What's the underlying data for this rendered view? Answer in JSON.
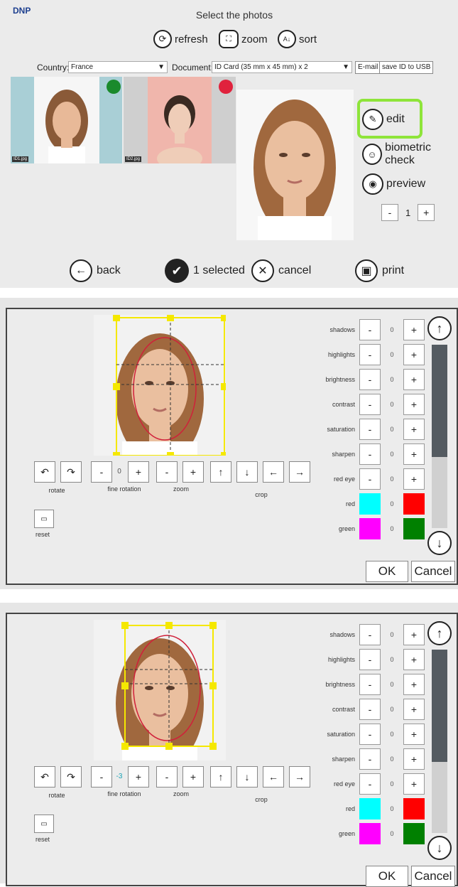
{
  "app": {
    "logo": "DNP",
    "title": "Select the photos"
  },
  "toolbar": {
    "refresh": "refresh",
    "zoom": "zoom",
    "sort": "sort"
  },
  "filters": {
    "country_label": "Country:",
    "country_value": "France",
    "document_label": "Document:",
    "document_value": "ID Card (35 mm x 45 mm) x 2",
    "email": "E-mail",
    "save_usb": "save ID to USB"
  },
  "thumbnails": [
    {
      "file": "ID1.jpg",
      "status_color": "#1a8a2c"
    },
    {
      "file": "ID2.jpg",
      "status_color": "#e0223d"
    }
  ],
  "actions": {
    "edit": "edit",
    "biometric": "biometric check",
    "preview": "preview"
  },
  "copies": {
    "minus": "-",
    "value": "1",
    "plus": "+"
  },
  "bottom": {
    "back": "back",
    "selected": "1 selected",
    "cancel": "cancel",
    "print": "print"
  },
  "editor": {
    "tools": {
      "rotate": "rotate",
      "fine_rotation": "fine rotation",
      "zoom": "zoom",
      "crop": "crop",
      "reset": "reset",
      "minus": "-",
      "plus": "+"
    },
    "adjustments": [
      {
        "label": "shadows",
        "value": "0"
      },
      {
        "label": "highlights",
        "value": "0"
      },
      {
        "label": "brightness",
        "value": "0"
      },
      {
        "label": "contrast",
        "value": "0"
      },
      {
        "label": "saturation",
        "value": "0"
      },
      {
        "label": "sharpen",
        "value": "0"
      },
      {
        "label": "red eye",
        "value": "0"
      }
    ],
    "color_adjust": [
      {
        "label": "red",
        "value": "0",
        "minus_color": "#00ffff",
        "plus_color": "#ff0000"
      },
      {
        "label": "green",
        "value": "0",
        "minus_color": "#ff00ff",
        "plus_color": "#008000"
      }
    ],
    "ok": "OK",
    "cancel": "Cancel",
    "panel1_fine_rotation_value": "0",
    "panel2_fine_rotation_value": "-3",
    "colors": {
      "crop_frame": "#f5e800",
      "oval": "#d0203a",
      "highlight": "#8ee43a"
    }
  }
}
